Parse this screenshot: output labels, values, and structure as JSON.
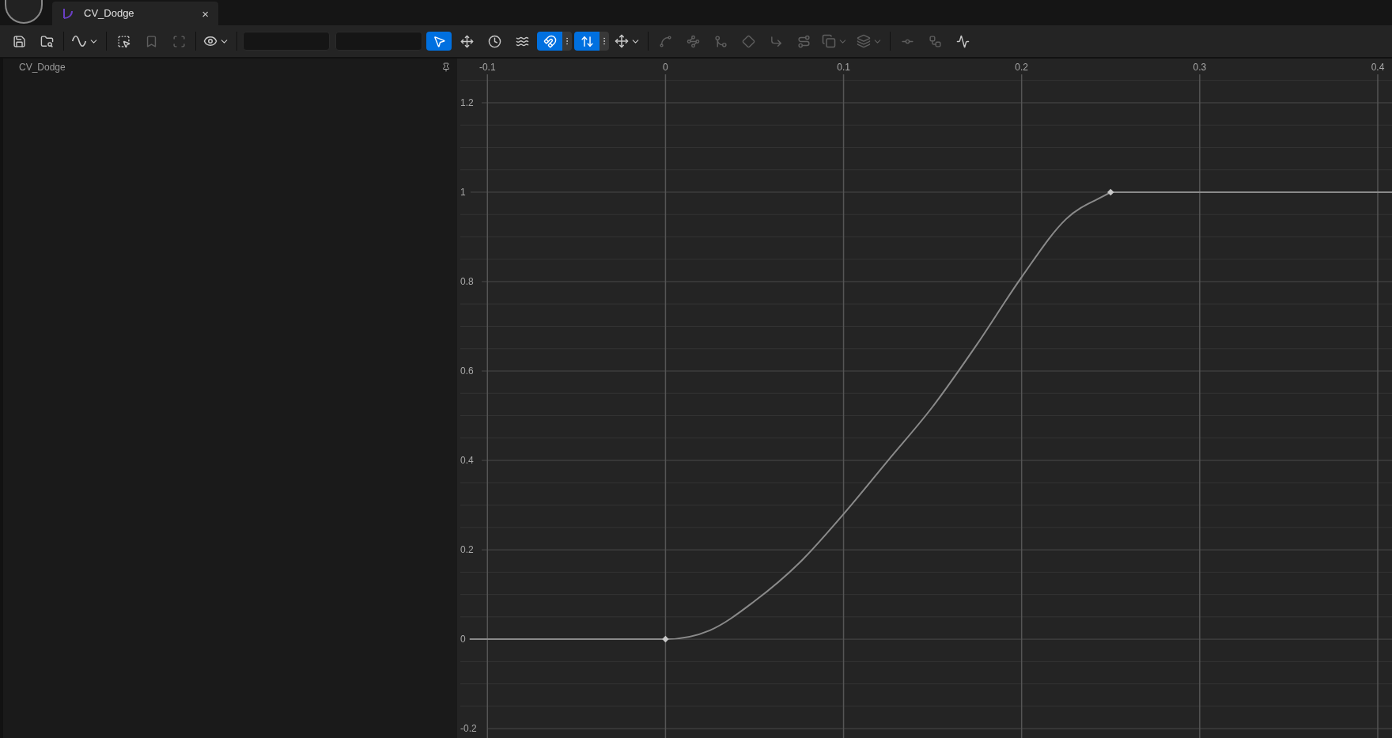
{
  "tab": {
    "title": "CV_Dodge",
    "close": "×"
  },
  "toolbar": {
    "groups": [
      [
        {
          "kind": "button",
          "selected": false,
          "disabled": false
        },
        {
          "kind": "button",
          "selected": false,
          "disabled": false
        }
      ],
      [
        {
          "kind": "dropdown",
          "selected": false,
          "disabled": false
        }
      ],
      [
        {
          "kind": "button",
          "selected": false,
          "disabled": false
        },
        {
          "kind": "button",
          "selected": false,
          "disabled": true
        },
        {
          "kind": "button",
          "selected": false,
          "disabled": true
        }
      ],
      [
        {
          "kind": "dropdown",
          "selected": false,
          "disabled": false
        }
      ],
      [
        {
          "kind": "field"
        },
        {
          "kind": "field"
        },
        {
          "kind": "button",
          "selected": true,
          "disabled": false
        },
        {
          "kind": "button",
          "selected": false,
          "disabled": false
        },
        {
          "kind": "button",
          "selected": false,
          "disabled": false
        },
        {
          "kind": "button",
          "selected": false,
          "disabled": false
        },
        {
          "kind": "snap",
          "selected": true,
          "disabled": false
        },
        {
          "kind": "snap",
          "selected": true,
          "disabled": false
        },
        {
          "kind": "dropdown",
          "selected": false,
          "disabled": false
        }
      ],
      [
        {
          "kind": "button",
          "selected": false,
          "disabled": true
        },
        {
          "kind": "button",
          "selected": false,
          "disabled": true
        },
        {
          "kind": "button",
          "selected": false,
          "disabled": true
        },
        {
          "kind": "button",
          "selected": false,
          "disabled": true
        },
        {
          "kind": "button",
          "selected": false,
          "disabled": true
        },
        {
          "kind": "button",
          "selected": false,
          "disabled": true
        },
        {
          "kind": "dropdown",
          "selected": false,
          "disabled": true
        },
        {
          "kind": "dropdown",
          "selected": false,
          "disabled": true
        }
      ],
      [
        {
          "kind": "button",
          "selected": false,
          "disabled": true
        },
        {
          "kind": "button",
          "selected": false,
          "disabled": true
        },
        {
          "kind": "button",
          "selected": false,
          "disabled": false
        }
      ]
    ]
  },
  "tree": {
    "items": [
      {
        "label": "CV_Dodge",
        "selected": false
      }
    ]
  },
  "graph": {
    "chart_data": {
      "type": "line",
      "xlim": [
        -0.117,
        0.408
      ],
      "ylim": [
        -0.221,
        1.299
      ],
      "xticks": [
        -0.1,
        0,
        0.1,
        0.2,
        0.3,
        0.4
      ],
      "yticks": [
        -0.2,
        0,
        0.2,
        0.4,
        0.6,
        0.8,
        1,
        1.2
      ],
      "x": [
        -0.11,
        0,
        0.025,
        0.05,
        0.075,
        0.1,
        0.125,
        0.15,
        0.175,
        0.2,
        0.225,
        0.25,
        0.408
      ],
      "grid": true,
      "series": [
        {
          "color": "#8a8a8a",
          "values": [
            0,
            0,
            0.02,
            0.085,
            0.17,
            0.28,
            0.4,
            0.52,
            0.66,
            0.81,
            0.94,
            1,
            1
          ]
        }
      ]
    }
  }
}
